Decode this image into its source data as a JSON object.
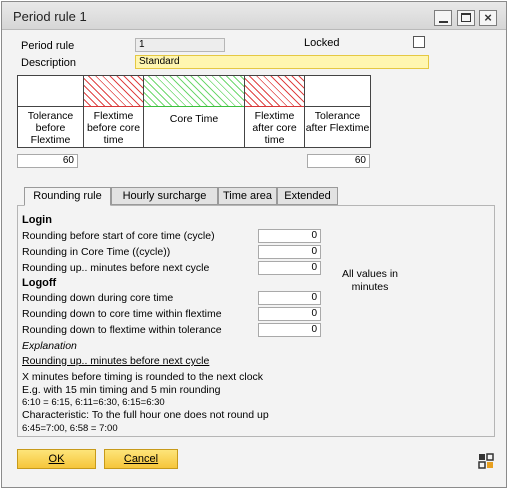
{
  "window": {
    "title": "Period rule 1"
  },
  "header": {
    "period_rule_label": "Period rule",
    "period_rule_value": "1",
    "description_label": "Description",
    "description_value": "Standard",
    "locked_label": "Locked",
    "locked_checked": false
  },
  "timeline": {
    "segments": [
      {
        "caption": "Tolerance before Flextime",
        "style": "plain"
      },
      {
        "caption": "Flextime before core time",
        "style": "red"
      },
      {
        "caption": "Core Time",
        "style": "green"
      },
      {
        "caption": "Flextime after core time",
        "style": "red"
      },
      {
        "caption": "Tolerance after Flextime",
        "style": "plain"
      }
    ],
    "tolerance_before_value": "60",
    "tolerance_after_value": "60"
  },
  "tabs": [
    "Rounding rule",
    "Hourly surcharge",
    "Time area",
    "Extended"
  ],
  "active_tab": "Rounding rule",
  "rounding": {
    "login_heading": "Login",
    "login_rows": [
      {
        "label": "Rounding before start of core time (cycle)",
        "value": "0"
      },
      {
        "label": "Rounding in Core Time ((cycle))",
        "value": "0"
      },
      {
        "label": "Rounding up.. minutes before next cycle",
        "value": "0"
      }
    ],
    "logoff_heading": "Logoff",
    "logoff_rows": [
      {
        "label": "Rounding down during core time",
        "value": "0"
      },
      {
        "label": "Rounding down to core time within flextime",
        "value": "0"
      },
      {
        "label": "Rounding down to flextime within tolerance",
        "value": "0"
      }
    ],
    "units_note": "All values in minutes",
    "explanation_label": "Explanation",
    "explanation_title": "Rounding up.. minutes before next cycle",
    "explanation_lines": [
      "X minutes before timing is rounded to the next clock",
      "E.g. with 15 min timing and 5 min rounding",
      "6:10 = 6:15, 6:11=6:30, 6:15=6:30",
      "Characteristic:  To the full hour one does not round up",
      "6:45=7:00, 6:58 = 7:00"
    ]
  },
  "buttons": {
    "ok": "OK",
    "cancel": "Cancel"
  },
  "colors": {
    "button_yellow": "#f6c53a",
    "field_yellow": "#fff6b0",
    "flextime_red": "#e04444",
    "core_green": "#6fd86f"
  }
}
